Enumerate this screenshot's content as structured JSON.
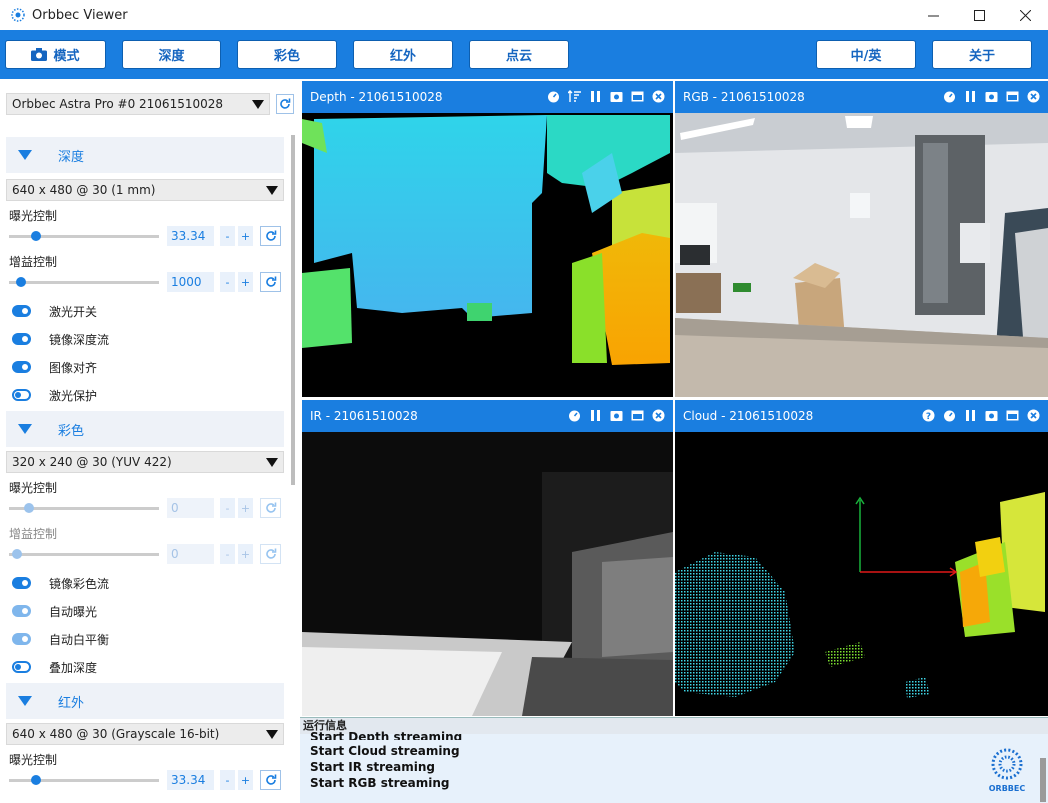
{
  "window": {
    "title": "Orbbec Viewer"
  },
  "toolbar": {
    "mode": "模式",
    "depth": "深度",
    "color": "彩色",
    "ir": "红外",
    "cloud": "点云",
    "lang": "中/英",
    "about": "关于"
  },
  "device": {
    "selected": "Orbbec Astra Pro #0 21061510028"
  },
  "depth_section": {
    "title": "深度",
    "mode": "640 x 480 @ 30 (1 mm)",
    "exposure_label": "曝光控制",
    "exposure_value": "33.34",
    "exposure_level": 0.18,
    "gain_label": "增益控制",
    "gain_value": "1000",
    "gain_level": 0.08,
    "toggles": [
      {
        "label": "激光开关",
        "on": true
      },
      {
        "label": "镜像深度流",
        "on": true
      },
      {
        "label": "图像对齐",
        "on": true
      },
      {
        "label": "激光保护",
        "on": false
      }
    ]
  },
  "color_section": {
    "title": "彩色",
    "mode": "320 x 240 @ 30 (YUV 422)",
    "exposure_label": "曝光控制",
    "exposure_value": "0",
    "exposure_level": 0.13,
    "gain_label": "增益控制",
    "gain_value": "0",
    "gain_level": 0.05,
    "toggles": [
      {
        "label": "镜像彩色流",
        "on": true
      },
      {
        "label": "自动曝光",
        "on": true
      },
      {
        "label": "自动白平衡",
        "on": true
      },
      {
        "label": "叠加深度",
        "on": false
      }
    ]
  },
  "ir_section": {
    "title": "红外",
    "mode": "640 x 480 @ 30 (Grayscale 16-bit)",
    "exposure_label": "曝光控制",
    "exposure_value": "33.34",
    "exposure_level": 0.18
  },
  "views": {
    "depth": "Depth - 21061510028",
    "rgb": "RGB - 21061510028",
    "ir": "IR - 21061510028",
    "cloud": "Cloud - 21061510028"
  },
  "log": {
    "title": "运行信息",
    "lines": [
      "Start Depth streaming",
      "Start Cloud streaming",
      "Start IR streaming",
      "Start RGB streaming"
    ],
    "brand": "ORBBEC"
  },
  "colors": {
    "accent": "#1a7ee0",
    "panel": "#eef2f8"
  }
}
